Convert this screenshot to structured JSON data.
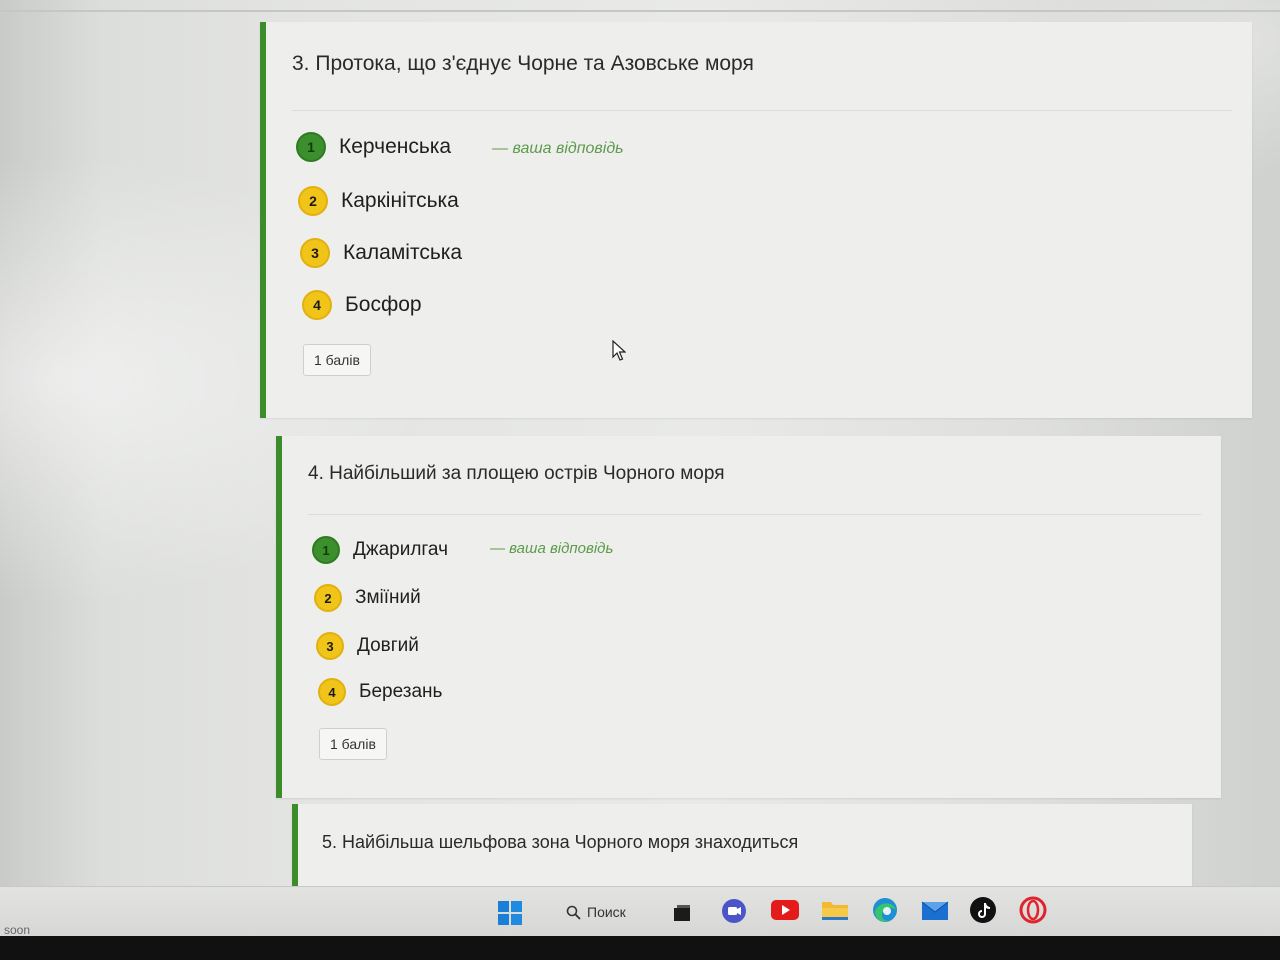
{
  "questions": [
    {
      "title": "3. Протока, що з'єднує Чорне та Азовське моря",
      "options": [
        {
          "number": "1",
          "label": "Керченська",
          "status": "correct"
        },
        {
          "number": "2",
          "label": "Каркінітська",
          "status": "neutral"
        },
        {
          "number": "3",
          "label": "Каламітська",
          "status": "neutral"
        },
        {
          "number": "4",
          "label": "Босфор",
          "status": "neutral"
        }
      ],
      "your_answer_note": "— ваша відповідь",
      "points": "1 балів"
    },
    {
      "title": "4. Найбільший за площею острів Чорного моря",
      "options": [
        {
          "number": "1",
          "label": "Джарилгач",
          "status": "correct"
        },
        {
          "number": "2",
          "label": "Зміїний",
          "status": "neutral"
        },
        {
          "number": "3",
          "label": "Довгий",
          "status": "neutral"
        },
        {
          "number": "4",
          "label": "Березань",
          "status": "neutral"
        }
      ],
      "your_answer_note": "— ваша відповідь",
      "points": "1 балів"
    },
    {
      "title": "5. Найбільша шельфова зона Чорного моря знаходиться"
    }
  ],
  "taskbar": {
    "left_text": "soon",
    "search_label": "Поиск",
    "icons": [
      "windows-start-icon",
      "search-icon",
      "task-view-icon",
      "chat-icon",
      "youtube-icon",
      "file-explorer-icon",
      "edge-browser-icon",
      "mail-icon",
      "tiktok-icon",
      "opera-icon"
    ]
  },
  "colors": {
    "accent_green": "#3d8c2c",
    "badge_yellow": "#f0c419",
    "badge_correct": "#3b8f2c",
    "your_answer_text": "#5d9a4c"
  }
}
